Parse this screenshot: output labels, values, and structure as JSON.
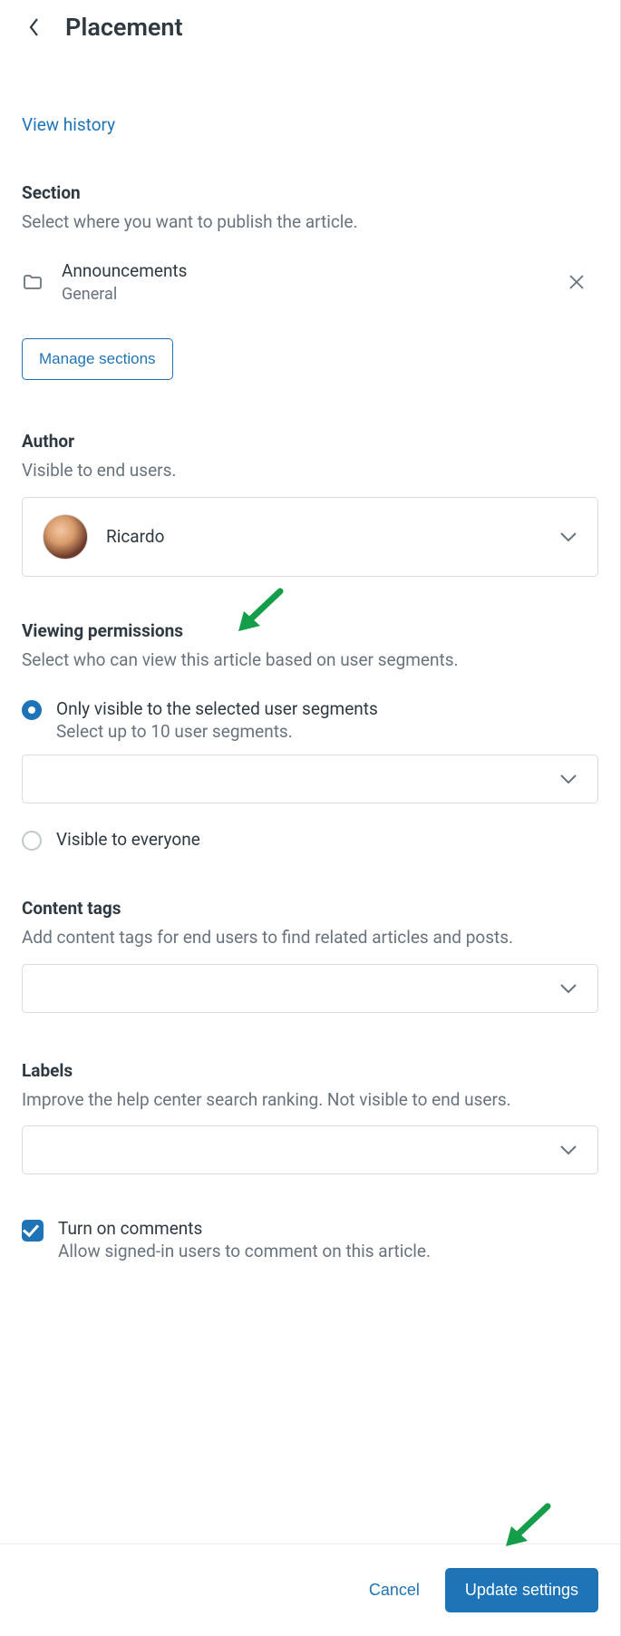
{
  "header": {
    "title": "Placement"
  },
  "view_history": "View history",
  "section": {
    "title": "Section",
    "desc": "Select where you want to publish the article.",
    "item": {
      "name": "Announcements",
      "category": "General"
    },
    "manage_btn": "Manage sections"
  },
  "author": {
    "title": "Author",
    "desc": "Visible to end users.",
    "name": "Ricardo"
  },
  "permissions": {
    "title": "Viewing permissions",
    "desc": "Select who can view this article based on user segments.",
    "opt1_label": "Only visible to the selected user segments",
    "opt1_sub": "Select up to 10 user segments.",
    "opt2_label": "Visible to everyone"
  },
  "tags": {
    "title": "Content tags",
    "desc": "Add content tags for end users to find related articles and posts."
  },
  "labels": {
    "title": "Labels",
    "desc": "Improve the help center search ranking. Not visible to end users."
  },
  "comments": {
    "label": "Turn on comments",
    "sub": "Allow signed-in users to comment on this article."
  },
  "footer": {
    "cancel": "Cancel",
    "update": "Update settings"
  }
}
